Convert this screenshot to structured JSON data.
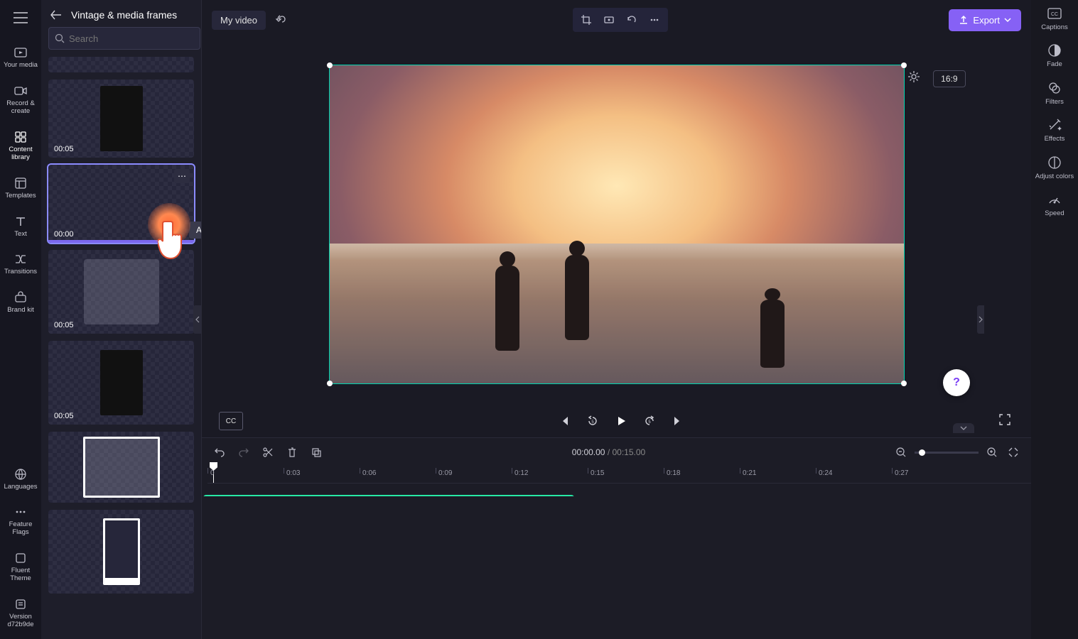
{
  "rail": {
    "your_media": "Your media",
    "record_create": "Record & create",
    "content_library": "Content library",
    "templates": "Templates",
    "text": "Text",
    "transitions": "Transitions",
    "brand_kit": "Brand kit",
    "languages": "Languages",
    "feature_flags": "Feature Flags",
    "fluent_theme": "Fluent Theme",
    "version": "Version d72b9de"
  },
  "panel": {
    "title": "Vintage & media frames",
    "search_placeholder": "Search",
    "tooltip": "Add to timeline",
    "thumbs": [
      {
        "dur": "",
        "kind": "short"
      },
      {
        "dur": "00:05",
        "kind": "portrait-dark"
      },
      {
        "dur": "00:00",
        "kind": "selected"
      },
      {
        "dur": "00:05",
        "kind": "portrait-grey"
      },
      {
        "dur": "00:05",
        "kind": "portrait-dark"
      },
      {
        "dur": "",
        "kind": "landscape-white"
      },
      {
        "dur": "",
        "kind": "portrait-white"
      }
    ]
  },
  "topbar": {
    "doc_title": "My video",
    "export": "Export",
    "ratio": "16:9"
  },
  "playbar": {
    "cc": "CC"
  },
  "timeline": {
    "current": "00:00.00",
    "sep": " / ",
    "total": "00:15.00",
    "ticks": [
      "0",
      "0:03",
      "0:06",
      "0:09",
      "0:12",
      "0:15",
      "0:18",
      "0:21",
      "0:24",
      "0:27"
    ]
  },
  "prail": {
    "captions": "Captions",
    "fade": "Fade",
    "filters": "Filters",
    "effects": "Effects",
    "adjust_colors": "Adjust colors",
    "speed": "Speed"
  },
  "help": "?"
}
